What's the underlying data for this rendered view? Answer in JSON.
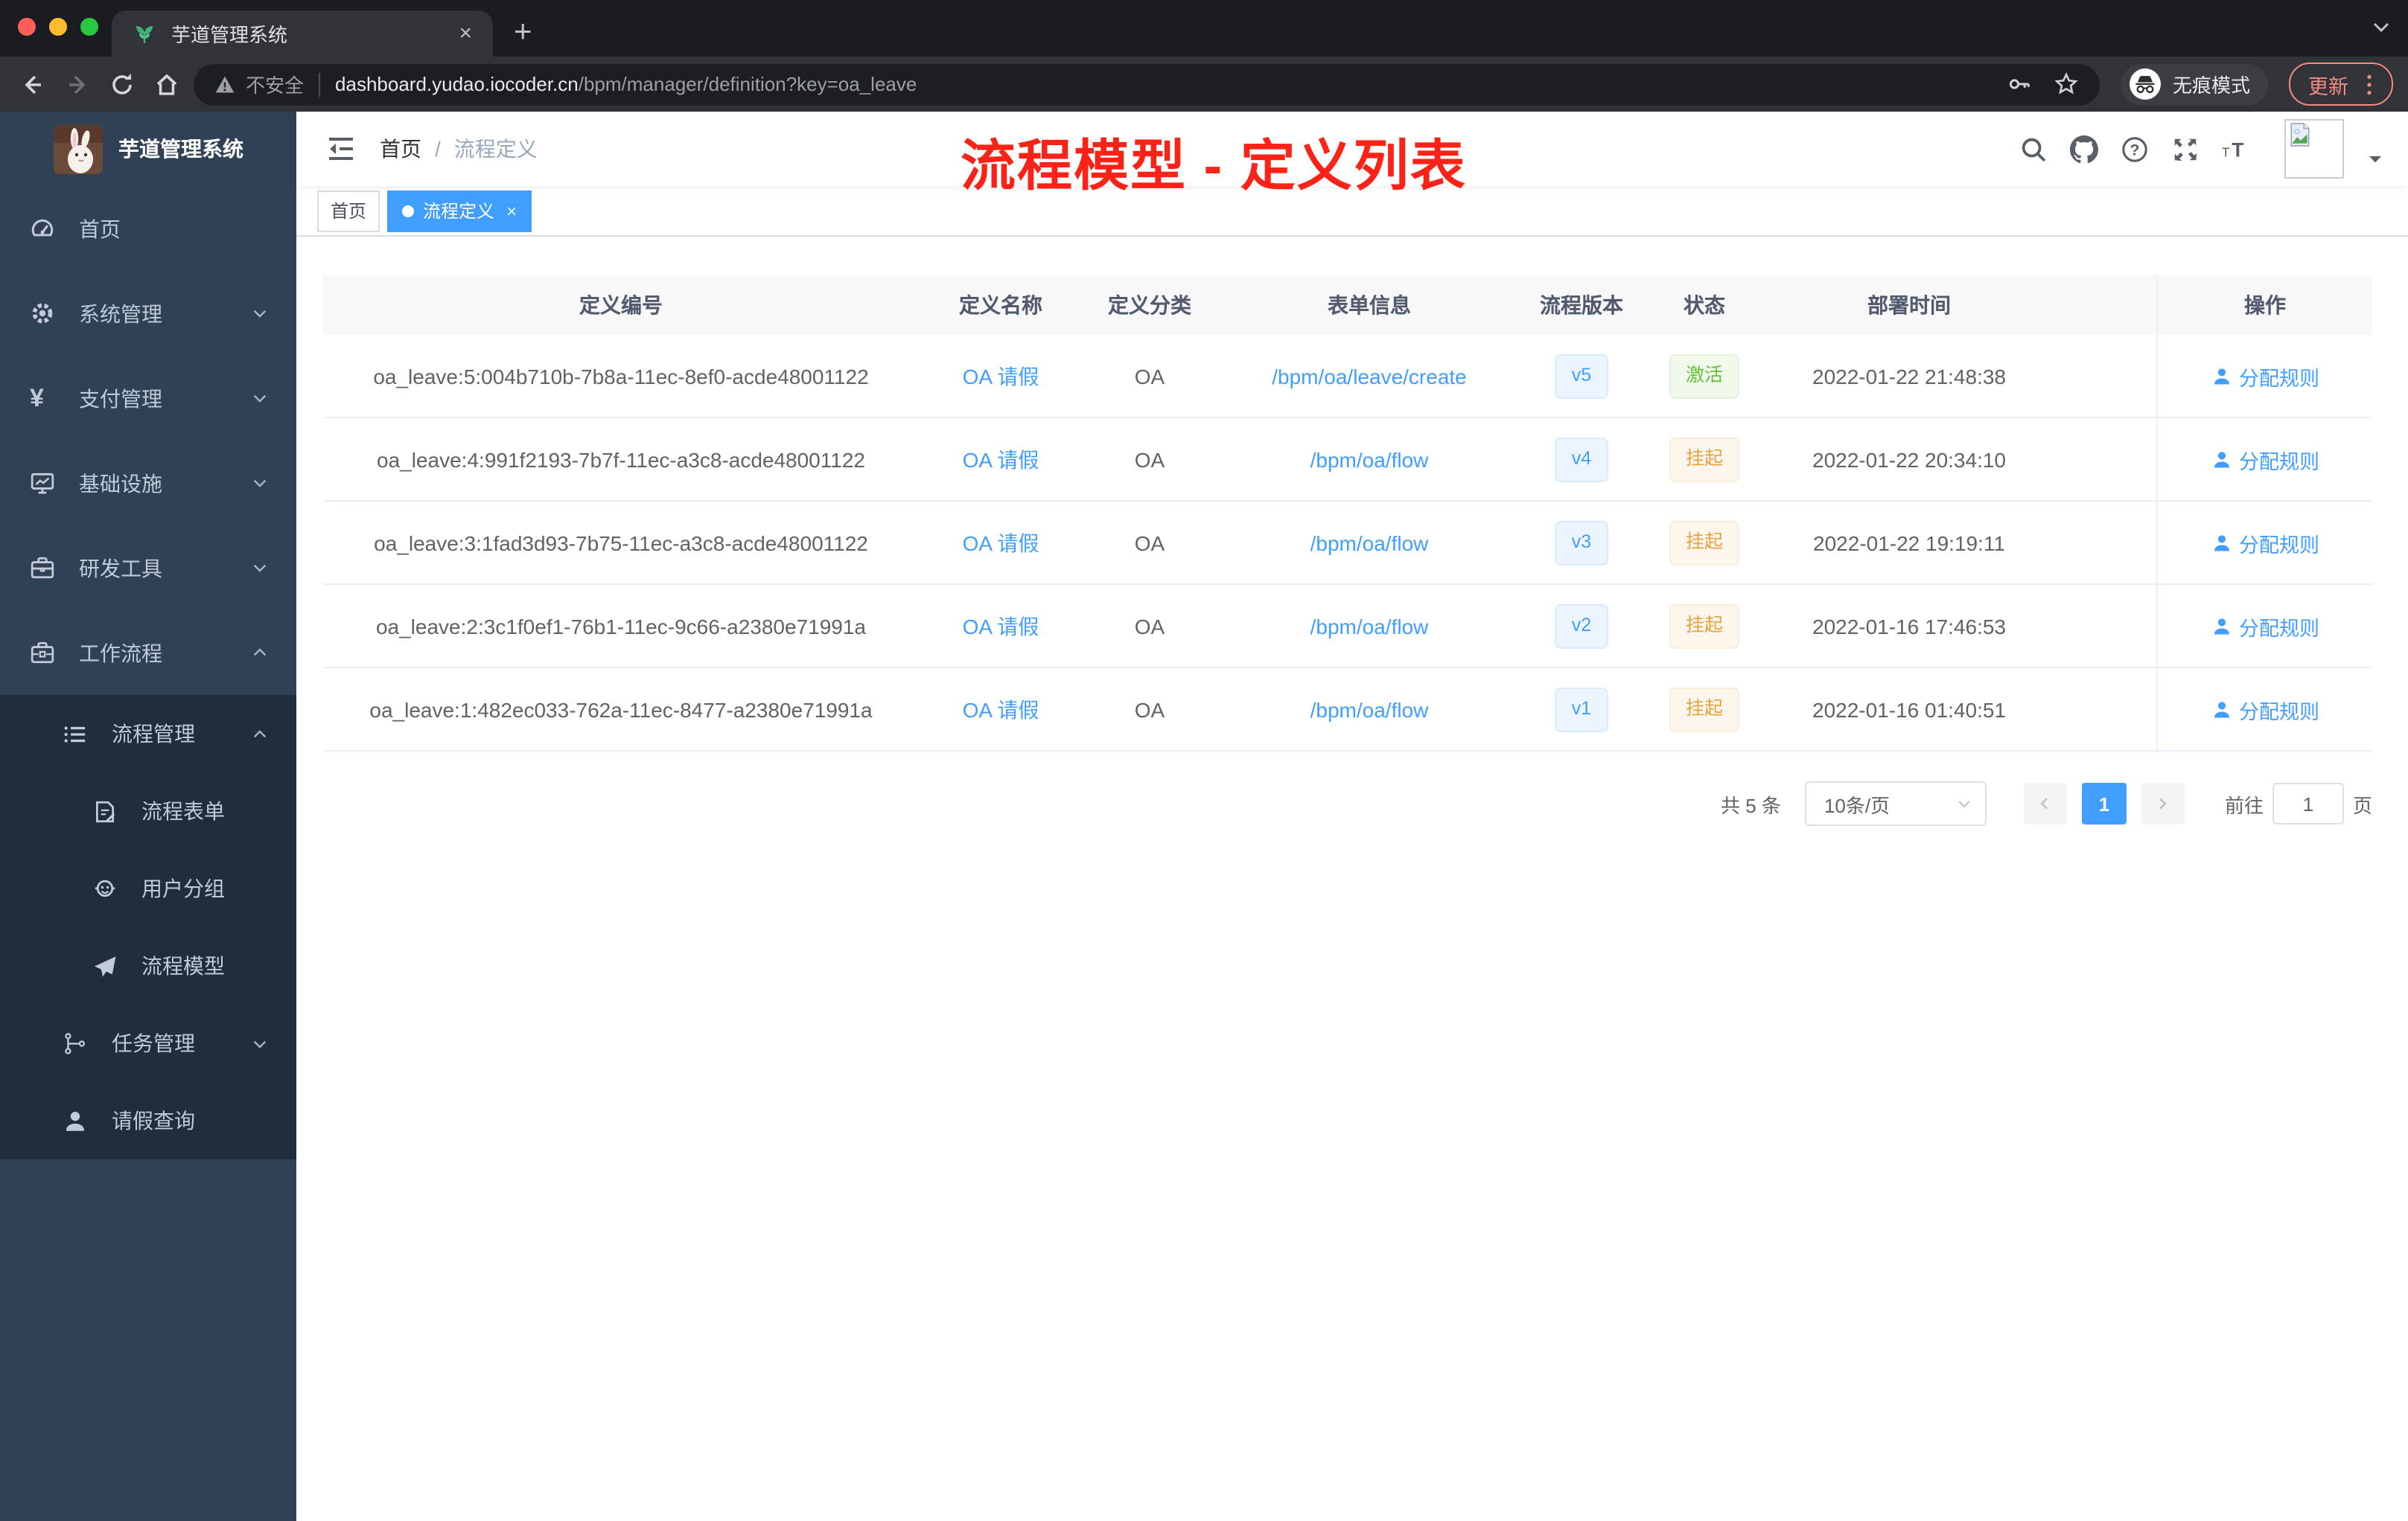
{
  "browser": {
    "tab": {
      "title": "芋道管理系统",
      "close": "×",
      "new_tab": "+",
      "favicon": "leaf-favicon"
    },
    "omnibox": {
      "warning_label": "不安全",
      "host": "dashboard.yudao.iocoder.cn",
      "path": "/bpm/manager/definition?key=oa_leave"
    },
    "incognito_label": "无痕模式",
    "update_label": "更新",
    "icons": {
      "back": "back-icon",
      "forward": "forward-icon",
      "reload": "reload-icon",
      "home": "home-icon",
      "warning": "warning-icon",
      "key": "key-icon",
      "star": "star-icon",
      "incognito": "incognito-icon",
      "dots": "dots-vertical-icon",
      "tabsearch": "chevron-down-icon",
      "favicon": "leaf-favicon"
    }
  },
  "sidebar": {
    "logo_title": "芋道管理系统",
    "logo_icon": "bunny-logo",
    "items": [
      {
        "slug": "home",
        "icon": "gauge-icon",
        "label": "首页",
        "level": 1
      },
      {
        "slug": "system-management",
        "icon": "gear-icon",
        "label": "系统管理",
        "level": 1,
        "arrow": "down"
      },
      {
        "slug": "payment-management",
        "icon": "yen-icon",
        "label": "支付管理",
        "level": 1,
        "arrow": "down"
      },
      {
        "slug": "infrastructure",
        "icon": "monitor-icon",
        "label": "基础设施",
        "level": 1,
        "arrow": "down"
      },
      {
        "slug": "dev-tools",
        "icon": "briefcase-icon",
        "label": "研发工具",
        "level": 1,
        "arrow": "down"
      },
      {
        "slug": "workflow",
        "icon": "toolbox-icon",
        "label": "工作流程",
        "level": 1,
        "arrow": "up"
      },
      {
        "slug": "process-management",
        "icon": "list-icon",
        "label": "流程管理",
        "level": 2,
        "arrow": "up"
      },
      {
        "slug": "process-form",
        "icon": "form-icon",
        "label": "流程表单",
        "level": 3
      },
      {
        "slug": "user-group",
        "icon": "people-icon",
        "label": "用户分组",
        "level": 3
      },
      {
        "slug": "process-model",
        "icon": "send-icon",
        "label": "流程模型",
        "level": 3
      },
      {
        "slug": "task-management",
        "icon": "tree-icon",
        "label": "任务管理",
        "level": 2,
        "arrow": "down"
      },
      {
        "slug": "leave-query",
        "icon": "user-icon",
        "label": "请假查询",
        "level": 2
      }
    ]
  },
  "navbar": {
    "breadcrumb": [
      {
        "label": "首页"
      },
      {
        "label": "流程定义"
      }
    ],
    "separator": "/",
    "annotation": "流程模型 - 定义列表",
    "icons": [
      {
        "slug": "search",
        "icon": "search-icon"
      },
      {
        "slug": "github",
        "icon": "github-icon"
      },
      {
        "slug": "help",
        "icon": "question-icon"
      },
      {
        "slug": "fullscreen",
        "icon": "fullscreen-icon"
      },
      {
        "slug": "font-size",
        "icon": "size-icon"
      }
    ]
  },
  "tags": [
    {
      "label": "首页",
      "active": false
    },
    {
      "label": "流程定义",
      "active": true,
      "close": "×"
    }
  ],
  "table": {
    "columns": [
      "定义编号",
      "定义名称",
      "定义分类",
      "表单信息",
      "流程版本",
      "状态",
      "部署时间",
      "操作"
    ],
    "rows": [
      {
        "id": "oa_leave:5:004b710b-7b8a-11ec-8ef0-acde48001122",
        "name": "OA 请假",
        "category": "OA",
        "form": "/bpm/oa/leave/create",
        "version": "v5",
        "status": {
          "label": "激活",
          "type": "success"
        },
        "deployed": "2022-01-22 21:48:38",
        "action": "分配规则"
      },
      {
        "id": "oa_leave:4:991f2193-7b7f-11ec-a3c8-acde48001122",
        "name": "OA 请假",
        "category": "OA",
        "form": "/bpm/oa/flow",
        "version": "v4",
        "status": {
          "label": "挂起",
          "type": "warning"
        },
        "deployed": "2022-01-22 20:34:10",
        "action": "分配规则"
      },
      {
        "id": "oa_leave:3:1fad3d93-7b75-11ec-a3c8-acde48001122",
        "name": "OA 请假",
        "category": "OA",
        "form": "/bpm/oa/flow",
        "version": "v3",
        "status": {
          "label": "挂起",
          "type": "warning"
        },
        "deployed": "2022-01-22 19:19:11",
        "action": "分配规则"
      },
      {
        "id": "oa_leave:2:3c1f0ef1-76b1-11ec-9c66-a2380e71991a",
        "name": "OA 请假",
        "category": "OA",
        "form": "/bpm/oa/flow",
        "version": "v2",
        "status": {
          "label": "挂起",
          "type": "warning"
        },
        "deployed": "2022-01-16 17:46:53",
        "action": "分配规则"
      },
      {
        "id": "oa_leave:1:482ec033-762a-11ec-8477-a2380e71991a",
        "name": "OA 请假",
        "category": "OA",
        "form": "/bpm/oa/flow",
        "version": "v1",
        "status": {
          "label": "挂起",
          "type": "warning"
        },
        "deployed": "2022-01-16 01:40:51",
        "action": "分配规则"
      }
    ]
  },
  "pagination": {
    "total": "共 5 条",
    "page_size": "10条/页",
    "current_page": "1",
    "goto_label": "前往",
    "goto_value": "1",
    "page_unit": "页"
  },
  "colors": {
    "accent": "#409eff",
    "success": "#67c23a",
    "warning": "#e6a23c",
    "sidebar_bg": "#304156",
    "submenu_bg": "#1f2d3d",
    "annotation": "#fb2318"
  }
}
